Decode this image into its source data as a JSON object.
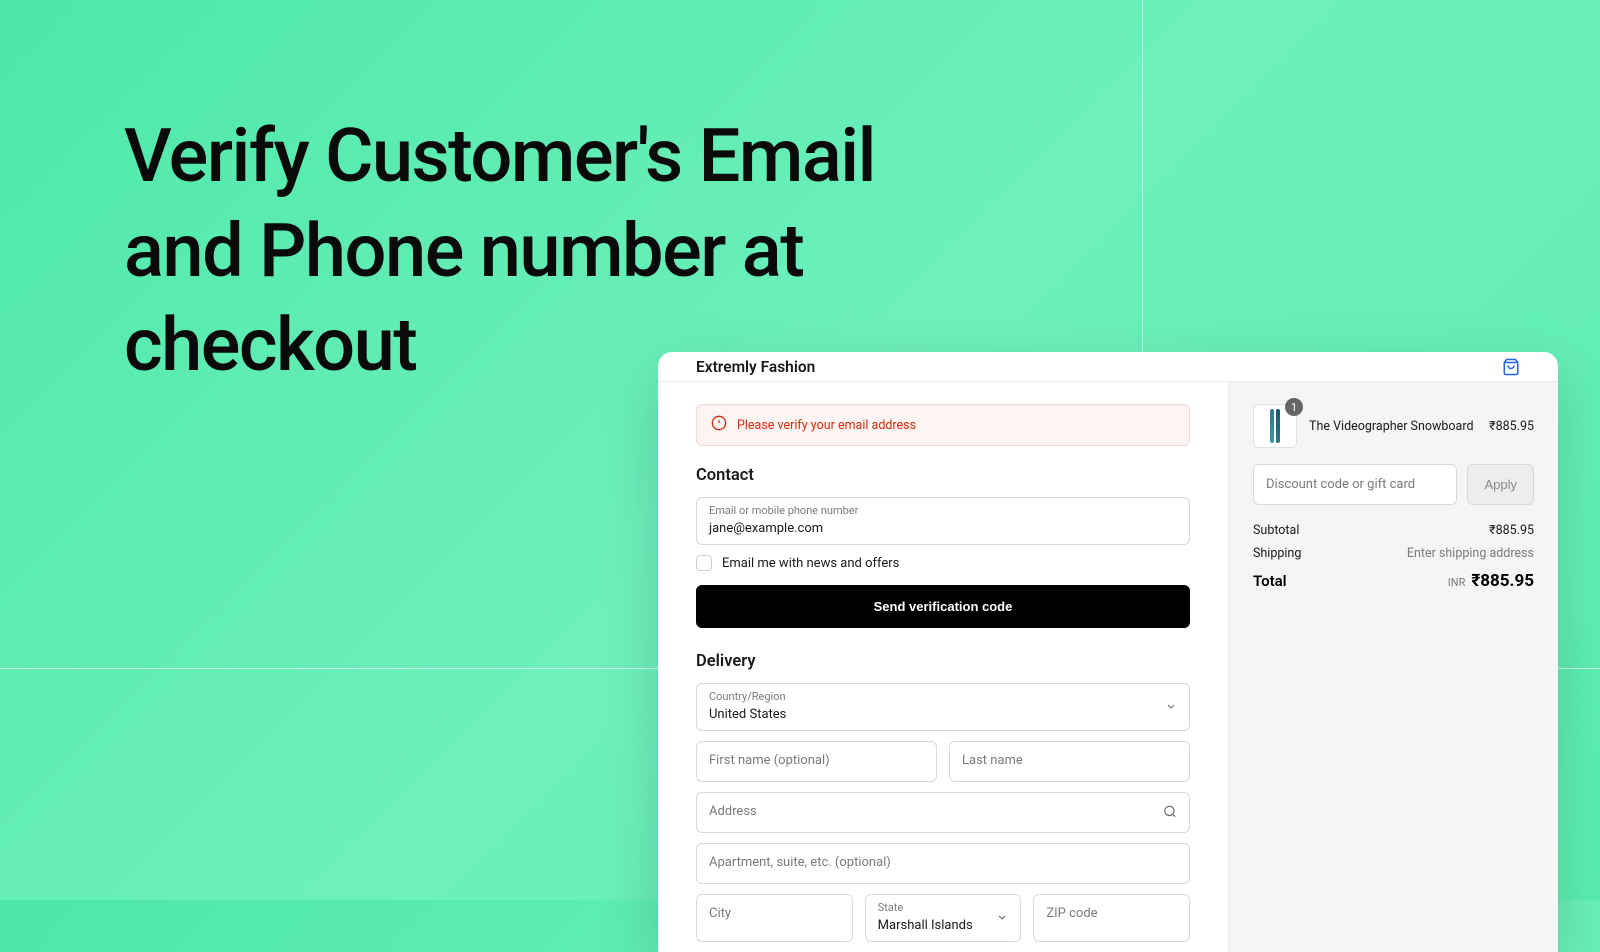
{
  "hero": {
    "title": "Verify Customer's Email\nand Phone number at\ncheckout"
  },
  "store": {
    "name": "Extremly Fashion"
  },
  "alert": {
    "message": "Please verify your email address"
  },
  "contact": {
    "title": "Contact",
    "field_label": "Email or mobile phone number",
    "field_value": "jane@example.com",
    "checkbox_label": "Email me with news and offers",
    "button_label": "Send verification code"
  },
  "delivery": {
    "title": "Delivery",
    "country_label": "Country/Region",
    "country_value": "United States",
    "first_name_placeholder": "First name (optional)",
    "last_name_placeholder": "Last name",
    "address_placeholder": "Address",
    "apt_placeholder": "Apartment, suite, etc. (optional)",
    "city_placeholder": "City",
    "state_label": "State",
    "state_value": "Marshall Islands",
    "zip_placeholder": "ZIP code"
  },
  "cart": {
    "item_name": "The Videographer Snowboard",
    "item_price": "₹885.95",
    "item_qty": "1",
    "discount_placeholder": "Discount code or gift card",
    "apply_label": "Apply",
    "subtotal_label": "Subtotal",
    "subtotal_value": "₹885.95",
    "shipping_label": "Shipping",
    "shipping_value": "Enter shipping address",
    "total_label": "Total",
    "currency_code": "INR",
    "total_value": "₹885.95"
  }
}
